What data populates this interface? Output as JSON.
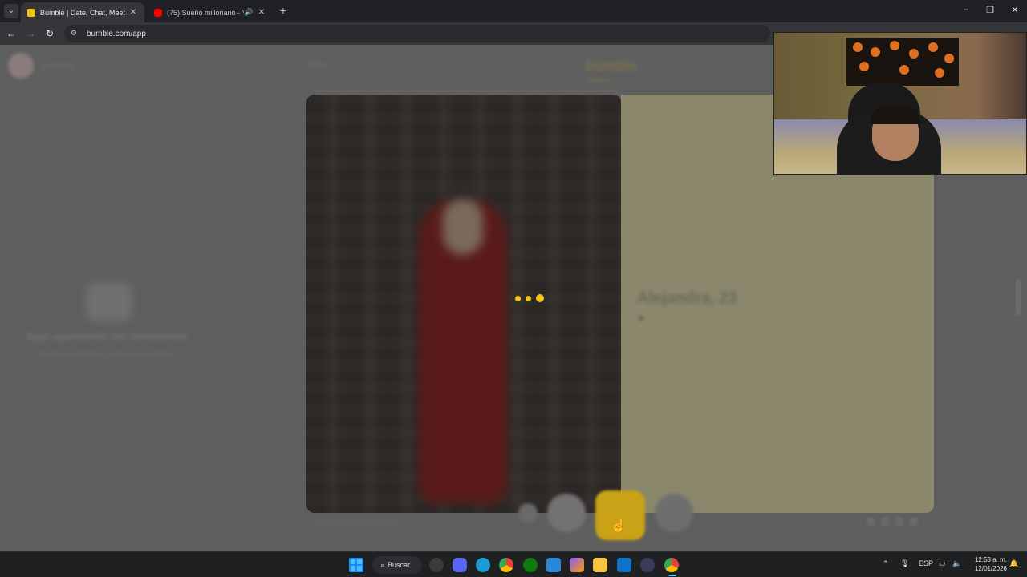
{
  "browser": {
    "tabs": [
      {
        "title": "Bumble | Date, Chat, Meet New",
        "active": true
      },
      {
        "title": "(75) Sueño millonario - You",
        "active": false
      }
    ],
    "url": "bumble.com/app"
  },
  "bumble": {
    "username": "Leandro",
    "filter_label": "Filtrar",
    "brand": "bumble",
    "empty_title": "Aquí aparecerán tus conexiones",
    "empty_subtitle": "Empieza a deslizar y conecta con alguien",
    "profile_name": "Alejandra, 23",
    "photo_footer": "Alejandra tiene más fotos"
  },
  "taskbar": {
    "search_label": "Buscar",
    "language": "ESP",
    "time": "12:53 a. m.",
    "date": "12/01/2026"
  },
  "colors": {
    "accent": "#f5c518",
    "taskbar_blue": "#4cc2ff"
  }
}
